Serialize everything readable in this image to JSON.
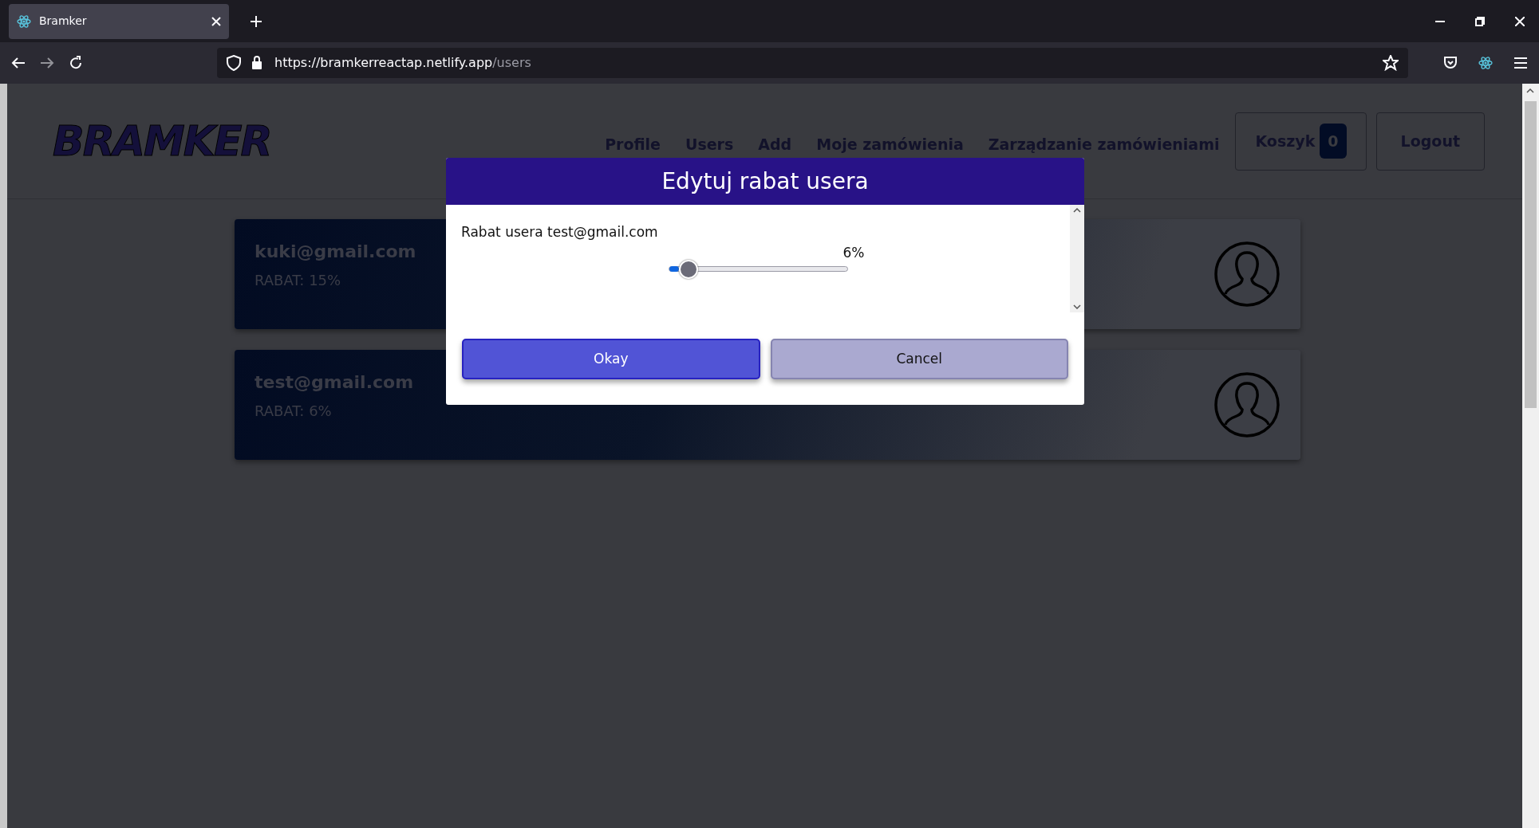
{
  "browser": {
    "tab_title": "Bramker",
    "url_origin": "https://bramkerreactap.netlify.app",
    "url_path": "/users"
  },
  "header": {
    "logo": "BRAMKER",
    "nav": [
      "Profile",
      "Users",
      "Add",
      "Moje zamówienia",
      "Zarządzanie zamówieniami"
    ],
    "cart": {
      "label": "Koszyk",
      "count": "0"
    },
    "logout": "Logout"
  },
  "users": [
    {
      "email": "kuki@gmail.com",
      "discount": "RABAT: 15%"
    },
    {
      "email": "test@gmail.com",
      "discount": "RABAT: 6%"
    }
  ],
  "modal": {
    "title": "Edytuj rabat usera",
    "label": "Rabat usera test@gmail.com",
    "slider": {
      "level": 0.06,
      "reading": "6%"
    },
    "buttons": [
      {
        "label": "Okay",
        "kind": "primary"
      },
      {
        "label": "Cancel",
        "kind": "secondary"
      }
    ]
  }
}
